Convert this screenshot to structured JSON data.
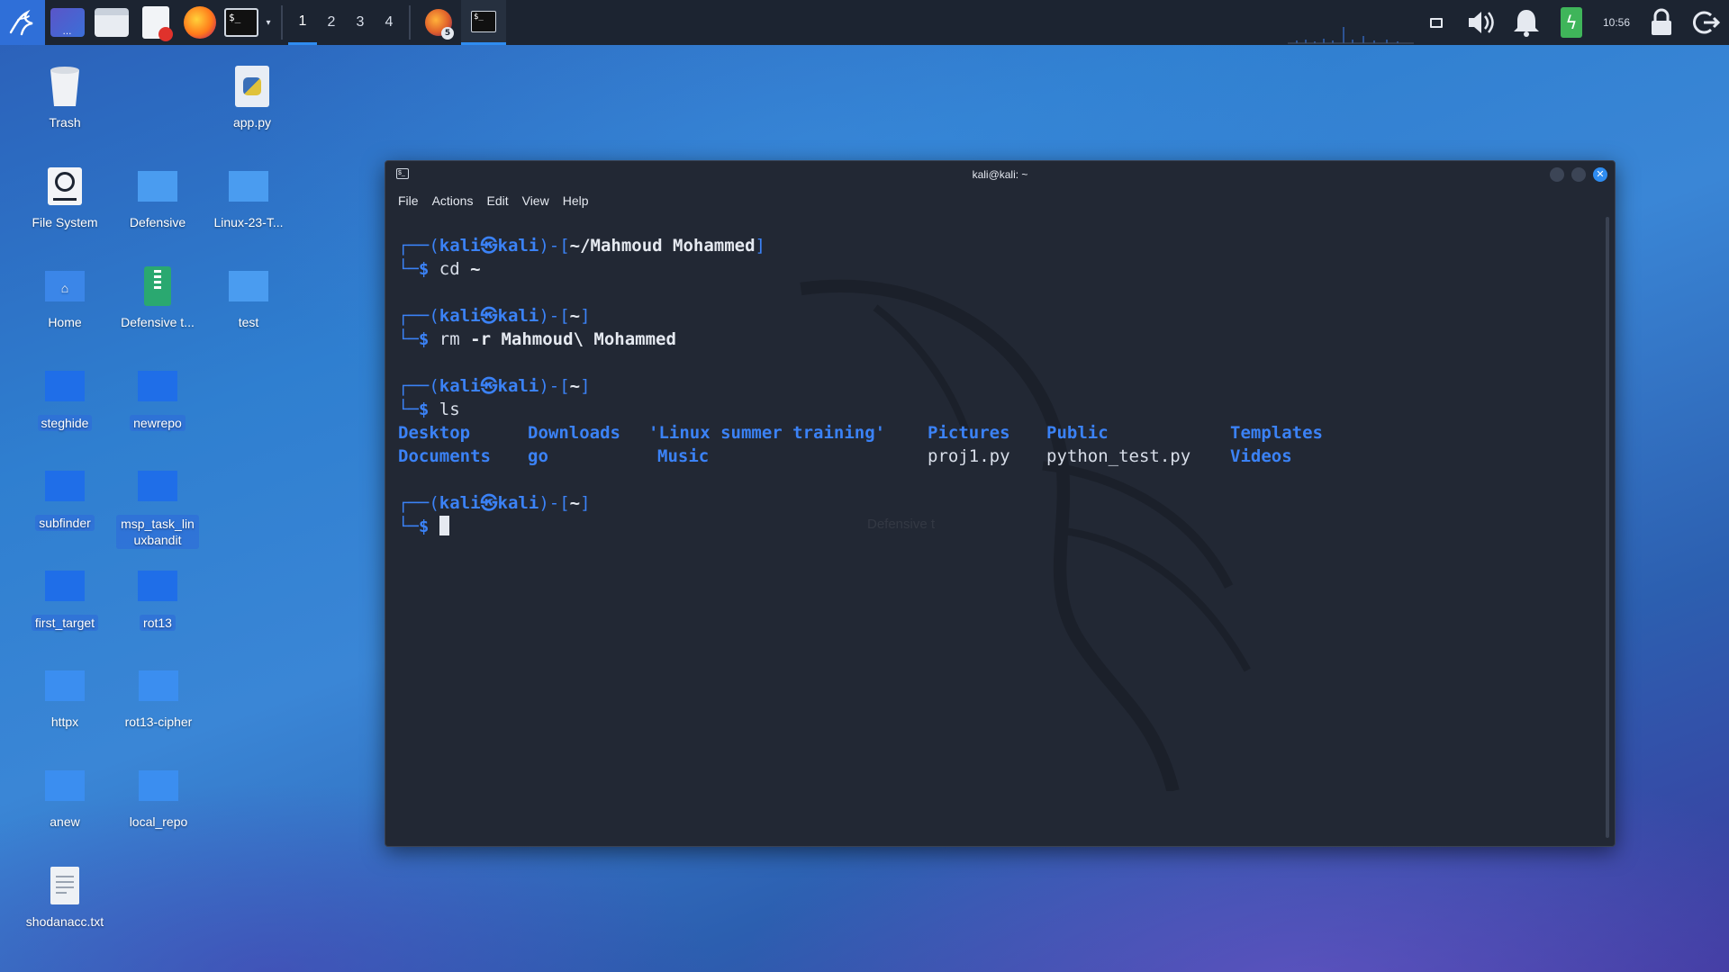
{
  "panel": {
    "workspaces": [
      "1",
      "2",
      "3",
      "4"
    ],
    "active_workspace": "1",
    "firefox_badge": "5",
    "clock": "10:56"
  },
  "desktop": {
    "icons": [
      {
        "label": "Trash",
        "type": "trash"
      },
      {
        "label": "app.py",
        "type": "python"
      },
      {
        "label": "File System",
        "type": "drive"
      },
      {
        "label": "Defensive",
        "type": "folder-light"
      },
      {
        "label": "Linux-23-T...",
        "type": "folder-light"
      },
      {
        "label": "Home",
        "type": "home"
      },
      {
        "label": "Defensive t...",
        "type": "archive"
      },
      {
        "label": "test",
        "type": "folder-light"
      },
      {
        "label": "steghide",
        "type": "folder"
      },
      {
        "label": "newrepo",
        "type": "folder"
      },
      {
        "label": "subfinder",
        "type": "folder"
      },
      {
        "label": "msp_task_lin uxbandit",
        "type": "folder"
      },
      {
        "label": "first_target",
        "type": "folder"
      },
      {
        "label": "rot13",
        "type": "folder"
      },
      {
        "label": "httpx",
        "type": "folder-light"
      },
      {
        "label": "rot13-cipher",
        "type": "folder-light"
      },
      {
        "label": "anew",
        "type": "folder-light"
      },
      {
        "label": "local_repo",
        "type": "folder-light"
      },
      {
        "label": "shodanacc.txt",
        "type": "text"
      }
    ]
  },
  "terminal": {
    "title": "kali@kali: ~",
    "menu": [
      "File",
      "Actions",
      "Edit",
      "View",
      "Help"
    ],
    "prompt_user": "kali",
    "prompt_at": "㉿",
    "prompt_host": "kali",
    "blocks": [
      {
        "dir": "~/Mahmoud Mohammed",
        "cmd": "cd",
        "args": "~"
      },
      {
        "dir": "~",
        "cmd": "rm",
        "args": "-r Mahmoud\\ Mohammed"
      },
      {
        "dir": "~",
        "cmd": "ls",
        "args": ""
      }
    ],
    "ls_row1": [
      "Desktop",
      "Downloads",
      "'Linux summer training'",
      "Pictures",
      "Public",
      "Templates"
    ],
    "ls_row2": [
      "Documents",
      "go",
      "Music",
      "proj1.py",
      "python_test.py",
      "Videos"
    ],
    "final_dir": "~",
    "watermark": "Defensive t"
  },
  "colors": {
    "accent": "#2f8cf0",
    "prompt_blue": "#3b82f6",
    "terminal_bg": "#222834",
    "panel_bg": "#1c2431"
  }
}
